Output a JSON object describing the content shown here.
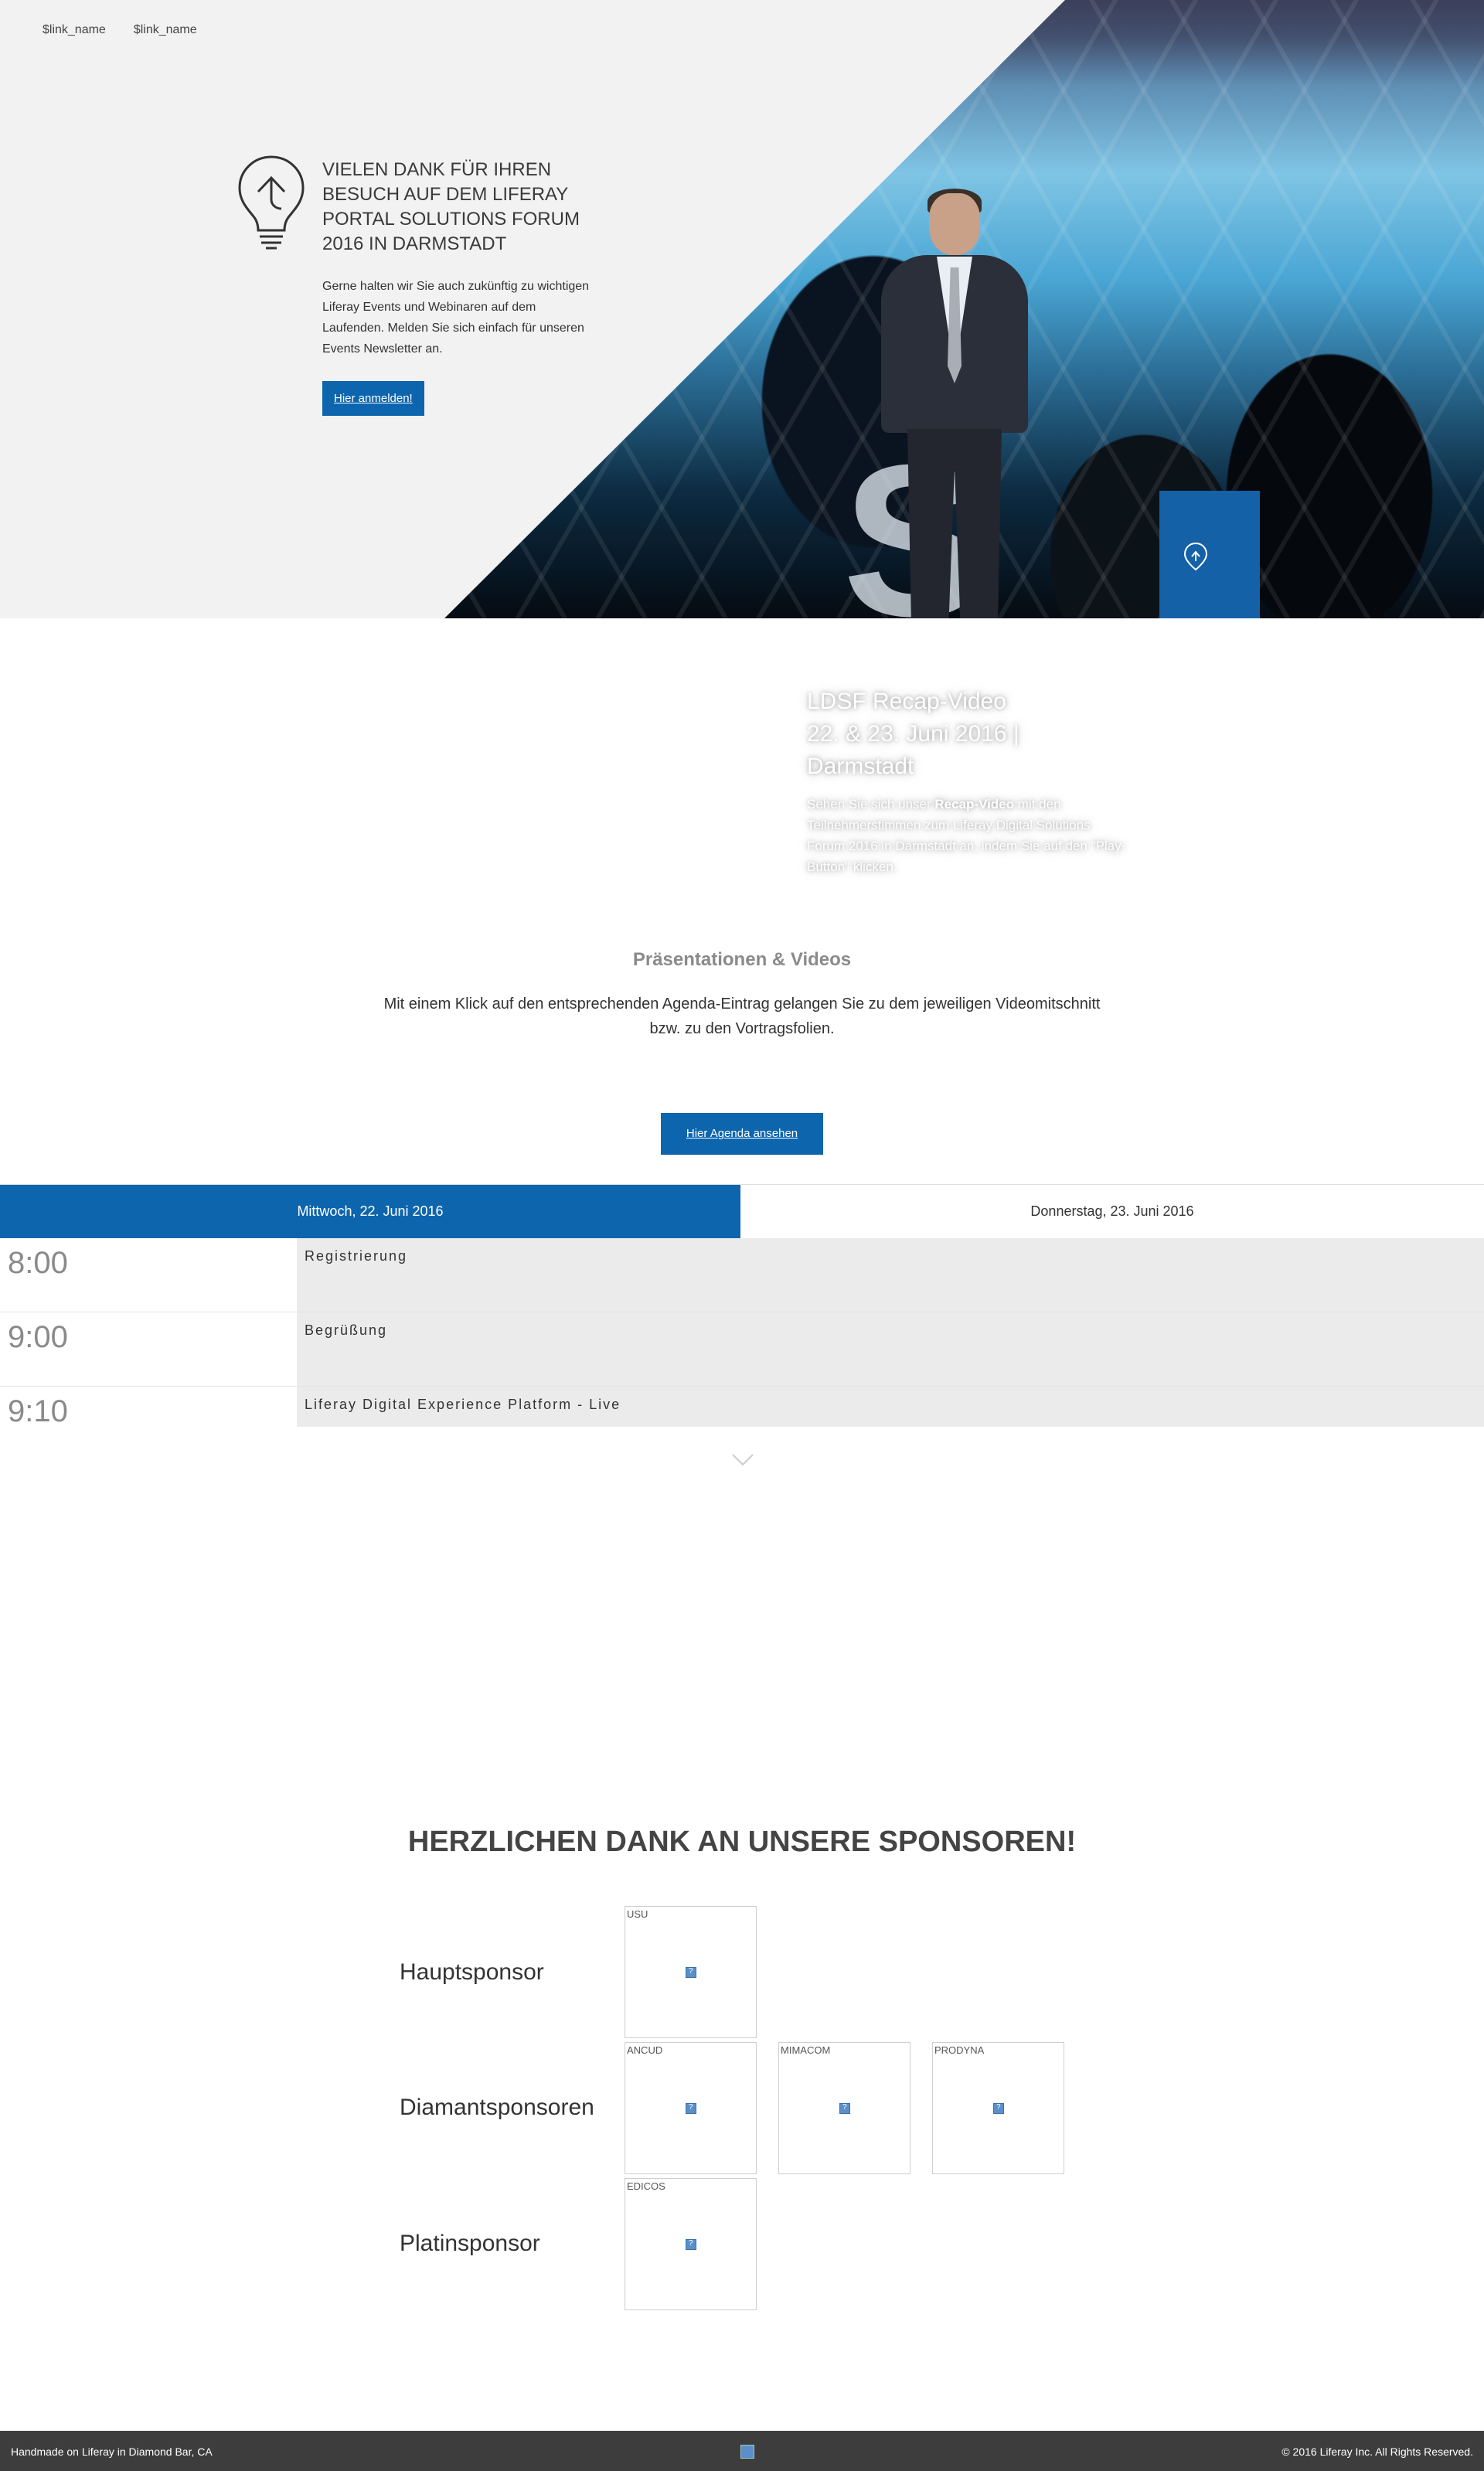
{
  "nav": {
    "links": [
      "$link_name",
      "$link_name"
    ]
  },
  "hero": {
    "title": "Vielen Dank für Ihren Besuch auf dem Liferay Portal Solutions Forum 2016 in Darmstadt",
    "copy": "Gerne halten wir Sie auch zukünftig zu wichtigen Liferay Events und Webinaren auf dem Laufenden. Melden Sie sich einfach für unseren Events Newsletter an.",
    "button": "Hier anmelden!"
  },
  "video": {
    "title_line1": "LDSF Recap-Video",
    "title_line2": "22. & 23. Juni 2016 | Darmstadt",
    "copy_pre": "Sehen Sie sich unser ",
    "copy_bold": "Recap-Video",
    "copy_post": " mit den Teilnehmerstimmen zum Liferay Digital Solutions Forum 2016 in Darmstadt an, indem Sie auf den \"Play-Button\" klicken."
  },
  "presentations": {
    "title": "Präsentationen & Videos",
    "copy": "Mit einem Klick auf den entsprechenden Agenda-Eintrag gelangen Sie zu dem jeweiligen Videomitschnitt bzw. zu den Vortragsfolien.",
    "button": "Hier Agenda ansehen"
  },
  "agenda": {
    "tabs": [
      "Mittwoch, 22. Juni 2016",
      "Donnerstag, 23. Juni 2016"
    ],
    "active_tab": 0,
    "sessions": [
      {
        "time": "8:00",
        "title": "Registrierung"
      },
      {
        "time": "9:00",
        "title": "Begrüßung"
      },
      {
        "time": "9:10",
        "title": "Liferay Digital Experience Platform - Live"
      }
    ]
  },
  "sponsors": {
    "title": "HERZLICHEN DANK AN UNSERE SPONSOREN!",
    "groups": [
      {
        "label": "Hauptsponsor",
        "logos": [
          "USU"
        ]
      },
      {
        "label": "Diamantsponsoren",
        "logos": [
          "ANCUD",
          "MIMACOM",
          "PRODYNA"
        ]
      },
      {
        "label": "Platinsponsor",
        "logos": [
          "EDICOS"
        ]
      }
    ]
  },
  "footer": {
    "left": "Handmade on Liferay in Diamond Bar, CA",
    "right": "© 2016 Liferay Inc. All Rights Reserved."
  },
  "colors": {
    "accent": "#0d65ad",
    "footer": "#3d3d3d",
    "hero_bg": "#f2f2f2"
  }
}
